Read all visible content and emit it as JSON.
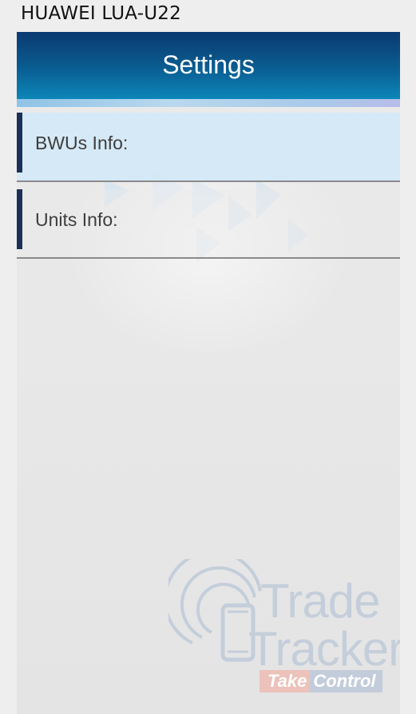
{
  "device": {
    "label": "HUAWEI LUA-U22"
  },
  "header": {
    "title": "Settings"
  },
  "settings": {
    "items": [
      {
        "label": "BWUs Info:"
      },
      {
        "label": "Units Info:"
      }
    ]
  },
  "watermark": {
    "brand_line1": "Trade",
    "brand_line2": "Tracker",
    "tagline_part1": "Take",
    "tagline_part2": "Control",
    "icon": "phone-signal-icon"
  },
  "colors": {
    "header_dark": "#0a3a70",
    "header_light": "#0c86b8",
    "selected_row": "#d2e8f6",
    "accent_bar": "#1c2f57",
    "watermark": "#c4cedb"
  }
}
